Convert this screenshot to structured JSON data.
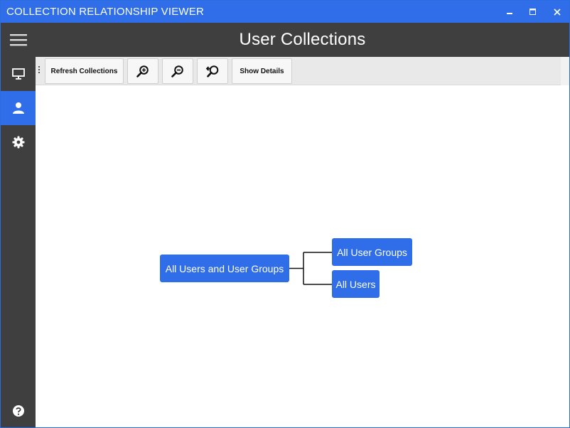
{
  "window": {
    "title": "COLLECTION RELATIONSHIP VIEWER",
    "controls": {
      "minimize_icon": "minimize-icon",
      "maximize_icon": "maximize-icon",
      "close_icon": "close-icon"
    }
  },
  "sidebar": {
    "items": [
      {
        "name": "menu",
        "icon": "hamburger-icon",
        "active": false
      },
      {
        "name": "devices",
        "icon": "monitor-icon",
        "active": false
      },
      {
        "name": "users",
        "icon": "user-icon",
        "active": true
      },
      {
        "name": "settings",
        "icon": "gear-icon",
        "active": false
      }
    ],
    "help_icon": "help-icon"
  },
  "header": {
    "title": "User Collections"
  },
  "toolbar": {
    "refresh_label": "Refresh Collections",
    "zoom_in_icon": "zoom-in-icon",
    "zoom_out_icon": "zoom-out-icon",
    "reset_zoom_icon": "reset-zoom-icon",
    "details_label": "Show Details"
  },
  "graph": {
    "root": "All Users and User Groups",
    "children": [
      "All User Groups",
      "All Users"
    ]
  },
  "colors": {
    "accent": "#2f6ee8",
    "sidebar": "#3f3f3f",
    "toolbar": "#e9e9e9"
  }
}
